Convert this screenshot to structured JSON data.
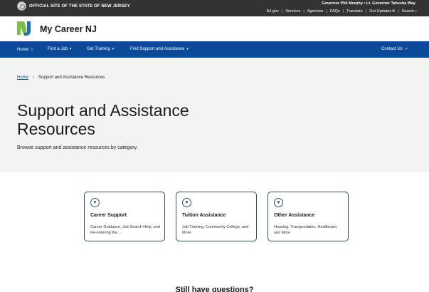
{
  "state_bar": {
    "official_text": "OFFICIAL SITE OF THE STATE OF NEW JERSEY",
    "governor_line": "Governor Phil Murphy • Lt. Governor Tahesha Way",
    "links": [
      {
        "label": "NJ.gov"
      },
      {
        "label": "Services"
      },
      {
        "label": "Agencies"
      },
      {
        "label": "FAQs"
      },
      {
        "label": "Translate"
      },
      {
        "label": "Get Updates"
      },
      {
        "label": "Search"
      }
    ]
  },
  "brand": {
    "name": "My Career NJ",
    "logo_colors": {
      "green": "#7ac143",
      "blue": "#1d6fb8"
    }
  },
  "nav": {
    "items": [
      {
        "label": "Home",
        "icon": "home-icon"
      },
      {
        "label": "Find a Job",
        "icon": "chevron-down-icon"
      },
      {
        "label": "Get Training",
        "icon": "chevron-down-icon"
      },
      {
        "label": "Find Support and Assistance",
        "icon": "chevron-down-icon"
      }
    ],
    "contact": {
      "label": "Contact Us",
      "icon": "external-link-icon"
    },
    "color": "#0b4a96"
  },
  "hero": {
    "breadcrumb": {
      "home": "Home",
      "current": "Support and Assistance Resources"
    },
    "title": "Support and Assistance Resources",
    "subtitle": "Browse support and assistance resources by category."
  },
  "cards": [
    {
      "title": "Career Support",
      "description": "Career Guidance, Job Search Help, and Re-entering the…",
      "icon": "heart-icon"
    },
    {
      "title": "Tuition Assistance",
      "description": "Job Training, Community College, and More",
      "icon": "heart-icon"
    },
    {
      "title": "Other Assistance",
      "description": "Housing, Transportation, Healthcare, and More",
      "icon": "heart-icon"
    }
  ],
  "footer_prompt": "Still have questions?"
}
